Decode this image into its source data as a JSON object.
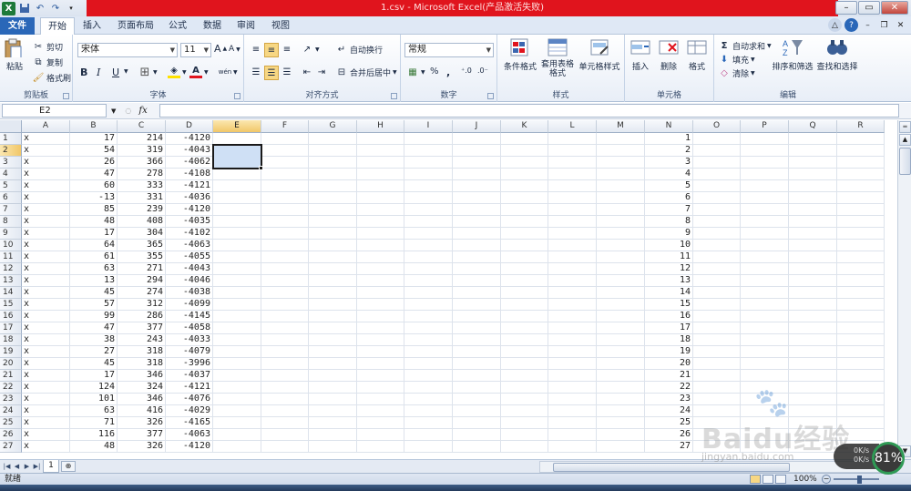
{
  "window": {
    "title": "1.csv - Microsoft Excel(产品激活失败)"
  },
  "tabs": [
    "文件",
    "开始",
    "插入",
    "页面布局",
    "公式",
    "数据",
    "审阅",
    "视图"
  ],
  "clipboard": {
    "paste": "粘贴",
    "cut": "剪切",
    "copy": "复制",
    "format_painter": "格式刷",
    "label": "剪贴板"
  },
  "font": {
    "name": "宋体",
    "size": "11",
    "label": "字体",
    "bold": "B",
    "italic": "I",
    "underline": "U",
    "grow": "A",
    "shrink": "A",
    "font_color_letter": "A",
    "wen": "wén"
  },
  "alignment": {
    "wrap": "自动换行",
    "merge": "合并后居中",
    "label": "对齐方式"
  },
  "number": {
    "format": "常规",
    "percent": "%",
    "comma": ",",
    "label": "数字"
  },
  "styles": {
    "conditional": "条件格式",
    "table_format": "套用表格格式",
    "cell_styles": "单元格样式",
    "label": "样式"
  },
  "cells": {
    "insert": "插入",
    "delete": "删除",
    "format": "格式",
    "label": "单元格"
  },
  "editing": {
    "autosum": "自动求和",
    "fill": "填充",
    "clear": "清除",
    "sort": "排序和筛选",
    "find": "查找和选择",
    "label": "编辑"
  },
  "formula_bar": {
    "name_box": "E2",
    "fx": "fx",
    "content": ""
  },
  "columns": [
    "A",
    "B",
    "C",
    "D",
    "E",
    "F",
    "G",
    "H",
    "I",
    "J",
    "K",
    "L",
    "M",
    "N",
    "O",
    "P",
    "Q",
    "R"
  ],
  "active_cell": {
    "col": "E",
    "row": 2
  },
  "rows": [
    {
      "n": "1",
      "a": "x",
      "b": "17",
      "c": "214",
      "d": "-4120"
    },
    {
      "n": "2",
      "a": "x",
      "b": "54",
      "c": "319",
      "d": "-4043"
    },
    {
      "n": "3",
      "a": "x",
      "b": "26",
      "c": "366",
      "d": "-4062"
    },
    {
      "n": "4",
      "a": "x",
      "b": "47",
      "c": "278",
      "d": "-4108"
    },
    {
      "n": "5",
      "a": "x",
      "b": "60",
      "c": "333",
      "d": "-4121"
    },
    {
      "n": "6",
      "a": "x",
      "b": "-13",
      "c": "331",
      "d": "-4036"
    },
    {
      "n": "7",
      "a": "x",
      "b": "85",
      "c": "239",
      "d": "-4120"
    },
    {
      "n": "8",
      "a": "x",
      "b": "48",
      "c": "408",
      "d": "-4035"
    },
    {
      "n": "9",
      "a": "x",
      "b": "17",
      "c": "304",
      "d": "-4102"
    },
    {
      "n": "10",
      "a": "x",
      "b": "64",
      "c": "365",
      "d": "-4063"
    },
    {
      "n": "11",
      "a": "x",
      "b": "61",
      "c": "355",
      "d": "-4055"
    },
    {
      "n": "12",
      "a": "x",
      "b": "63",
      "c": "271",
      "d": "-4043"
    },
    {
      "n": "13",
      "a": "x",
      "b": "13",
      "c": "294",
      "d": "-4046"
    },
    {
      "n": "14",
      "a": "x",
      "b": "45",
      "c": "274",
      "d": "-4038"
    },
    {
      "n": "15",
      "a": "x",
      "b": "57",
      "c": "312",
      "d": "-4099"
    },
    {
      "n": "16",
      "a": "x",
      "b": "99",
      "c": "286",
      "d": "-4145"
    },
    {
      "n": "17",
      "a": "x",
      "b": "47",
      "c": "377",
      "d": "-4058"
    },
    {
      "n": "18",
      "a": "x",
      "b": "38",
      "c": "243",
      "d": "-4033"
    },
    {
      "n": "19",
      "a": "x",
      "b": "27",
      "c": "318",
      "d": "-4079"
    },
    {
      "n": "20",
      "a": "x",
      "b": "45",
      "c": "318",
      "d": "-3996"
    },
    {
      "n": "21",
      "a": "x",
      "b": "17",
      "c": "346",
      "d": "-4037"
    },
    {
      "n": "22",
      "a": "x",
      "b": "124",
      "c": "324",
      "d": "-4121"
    },
    {
      "n": "23",
      "a": "x",
      "b": "101",
      "c": "346",
      "d": "-4076"
    },
    {
      "n": "24",
      "a": "x",
      "b": "63",
      "c": "416",
      "d": "-4029"
    },
    {
      "n": "25",
      "a": "x",
      "b": "71",
      "c": "326",
      "d": "-4165"
    },
    {
      "n": "26",
      "a": "x",
      "b": "116",
      "c": "377",
      "d": "-4063"
    },
    {
      "n": "27",
      "a": "x",
      "b": "48",
      "c": "326",
      "d": "-4120"
    }
  ],
  "sheet_tab": "1",
  "status": {
    "ready": "就绪",
    "zoom": "100%",
    "zoom_minus": "−"
  },
  "net_widget": {
    "up": "0K/s",
    "down": "0K/s",
    "percent": "81%"
  },
  "watermark": {
    "text": "Baidu经验",
    "sub": "jingyan.baidu.com"
  },
  "colors": {
    "title_red": "#e0141d",
    "file_tab": "#2a67b8",
    "selection_fill": "#cfe0f5",
    "header_active": "#f1c768"
  }
}
